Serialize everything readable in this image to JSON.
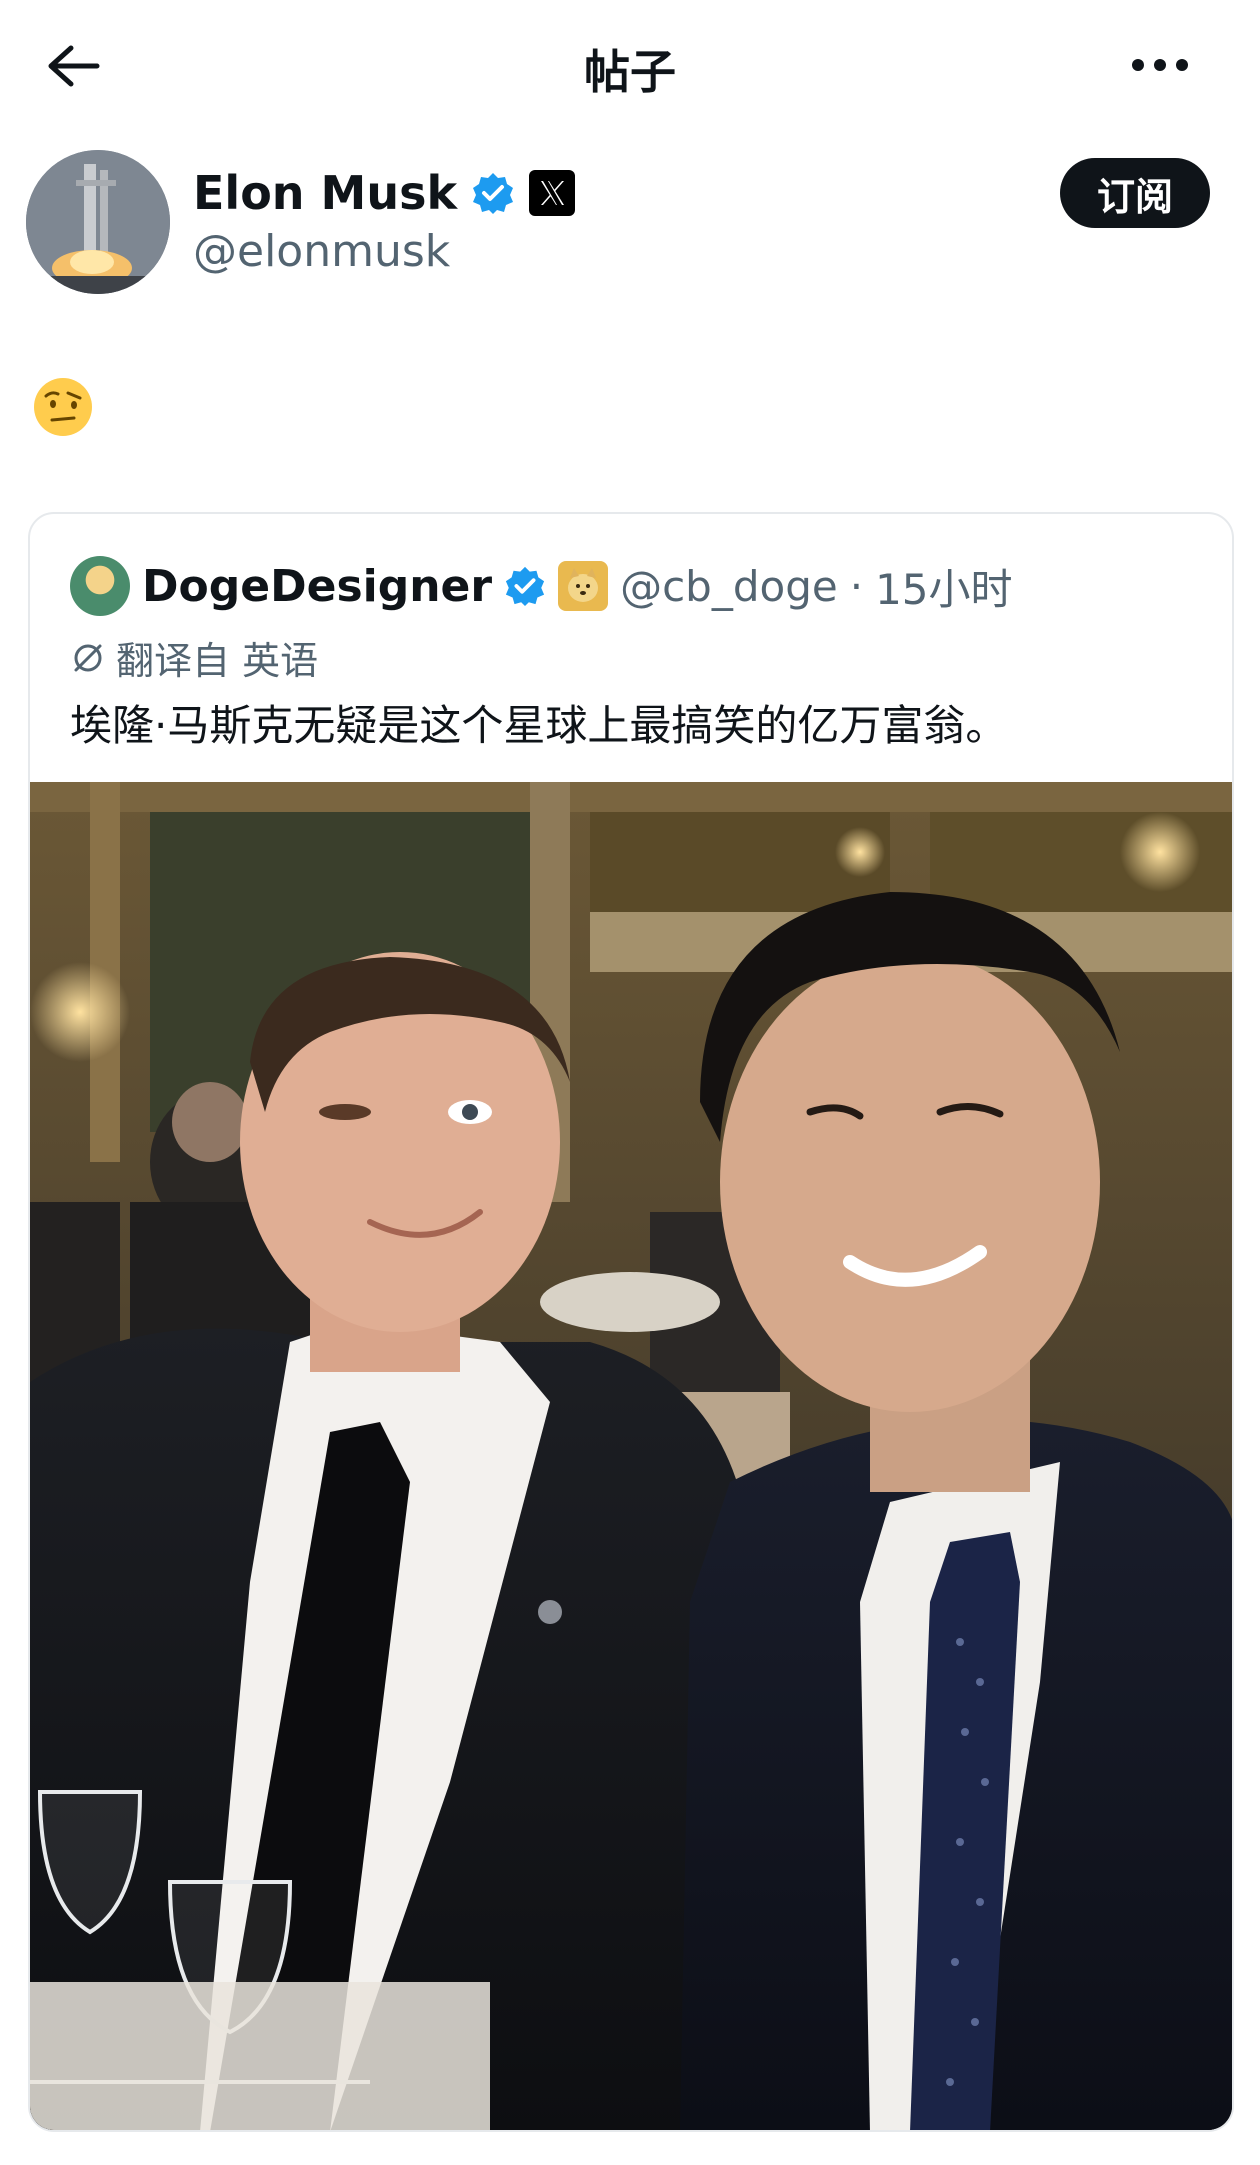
{
  "header": {
    "title": "帖子"
  },
  "post": {
    "author_name": "Elon Musk",
    "author_handle": "@elonmusk",
    "subscribe_label": "订阅",
    "body_emoji": "face-with-raised-eyebrow",
    "icons": {
      "verified": "verified-badge-icon",
      "affiliation": "x-logo-icon"
    }
  },
  "quoted": {
    "name": "DogeDesigner",
    "handle": "@cb_doge",
    "separator": "·",
    "time": "15小时",
    "translate_label": "翻译自 英语",
    "text": "埃隆·马斯克无疑是这个星球上最搞笑的亿万富翁。"
  },
  "colors": {
    "verified_blue": "#1d9bf0",
    "text_primary": "#0f1419",
    "text_secondary": "#536471"
  }
}
